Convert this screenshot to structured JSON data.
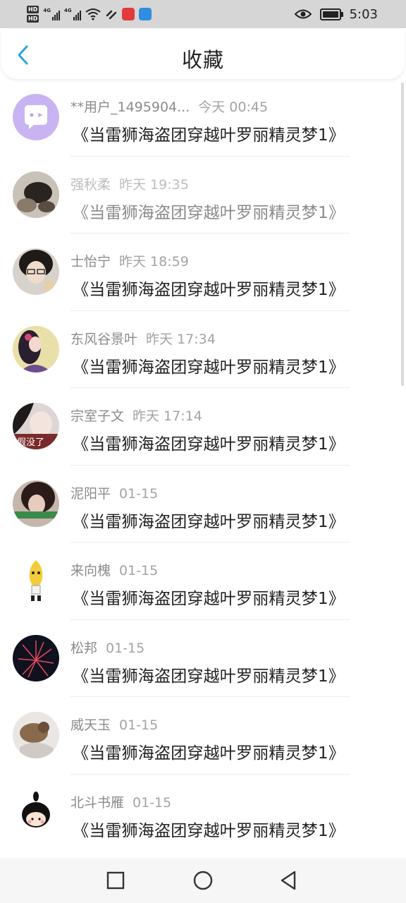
{
  "status_bar": {
    "hd_top": "HD",
    "hd_bottom": "HD",
    "net1": "4G",
    "net2": "4G",
    "time": "5:03",
    "battery_level": 0.85
  },
  "header": {
    "title": "收藏"
  },
  "items": [
    {
      "name": "**用户_1495904...",
      "time": "今天 00:45",
      "title": "《当雷狮海盗团穿越叶罗丽精灵梦1》"
    },
    {
      "name": "强秋柔",
      "time": "昨天 19:35",
      "title": "《当雷狮海盗团穿越叶罗丽精灵梦1》"
    },
    {
      "name": "士怡宁",
      "time": "昨天 18:59",
      "title": "《当雷狮海盗团穿越叶罗丽精灵梦1》"
    },
    {
      "name": "东风谷景叶",
      "time": "昨天 17:34",
      "title": "《当雷狮海盗团穿越叶罗丽精灵梦1》"
    },
    {
      "name": "宗室子文",
      "time": "昨天 17:14",
      "title": "《当雷狮海盗团穿越叶罗丽精灵梦1》"
    },
    {
      "name": "泥阳平",
      "time": "01-15",
      "title": "《当雷狮海盗团穿越叶罗丽精灵梦1》"
    },
    {
      "name": "来向槐",
      "time": "01-15",
      "title": "《当雷狮海盗团穿越叶罗丽精灵梦1》"
    },
    {
      "name": "松邦",
      "time": "01-15",
      "title": "《当雷狮海盗团穿越叶罗丽精灵梦1》"
    },
    {
      "name": "威天玉",
      "time": "01-15",
      "title": "《当雷狮海盗团穿越叶罗丽精灵梦1》"
    },
    {
      "name": "北斗书雁",
      "time": "01-15",
      "title": "《当雷狮海盗团穿越叶罗丽精灵梦1》"
    }
  ],
  "avatar_captions": {
    "row5": "假没了"
  },
  "colors": {
    "accent": "#29a3e0",
    "status_bar_bg": "#d6d6d6",
    "default_avatar": "#c8b4f2"
  },
  "icons": {
    "back": "chevron-left-icon",
    "nav_recent": "square-icon",
    "nav_home": "circle-icon",
    "nav_back": "triangle-back-icon"
  }
}
